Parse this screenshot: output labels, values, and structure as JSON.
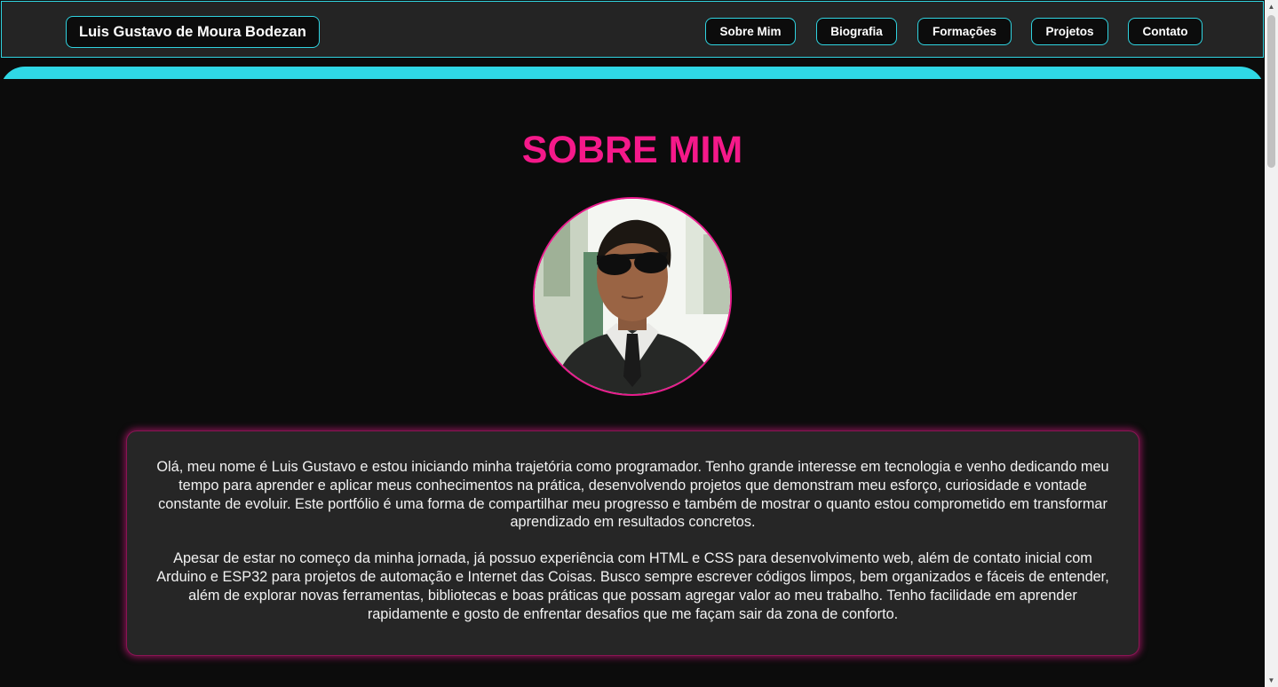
{
  "header": {
    "brand": "Luis Gustavo de Moura Bodezan",
    "nav": [
      {
        "label": "Sobre Mim"
      },
      {
        "label": "Biografia"
      },
      {
        "label": "Formações"
      },
      {
        "label": "Projetos"
      },
      {
        "label": "Contato"
      }
    ]
  },
  "about": {
    "title": "SOBRE MIM",
    "paragraphs": [
      "Olá, meu nome é Luis Gustavo e estou iniciando minha trajetória como programador. Tenho grande interesse em tecnologia e venho dedicando meu tempo para aprender e aplicar meus conhecimentos na prática, desenvolvendo projetos que demonstram meu esforço, curiosidade e vontade constante de evoluir. Este portfólio é uma forma de compartilhar meu progresso e também de mostrar o quanto estou comprometido em transformar aprendizado em resultados concretos.",
      "Apesar de estar no começo da minha jornada, já possuo experiência com HTML e CSS para desenvolvimento web, além de contato inicial com Arduino e ESP32 para projetos de automação e Internet das Coisas. Busco sempre escrever códigos limpos, bem organizados e fáceis de entender, além de explorar novas ferramentas, bibliotecas e boas práticas que possam agregar valor ao meu trabalho. Tenho facilidade em aprender rapidamente e gosto de enfrentar desafios que me façam sair da zona de conforto."
    ]
  },
  "colors": {
    "accent_cyan": "#2fd8e6",
    "accent_pink": "#f5198a",
    "background": "#0c0c0c",
    "header_bg": "#242424",
    "card_bg": "#262626"
  },
  "icons": {
    "scroll_up": "scroll-up-arrow-icon",
    "scroll_down": "scroll-down-arrow-icon"
  }
}
